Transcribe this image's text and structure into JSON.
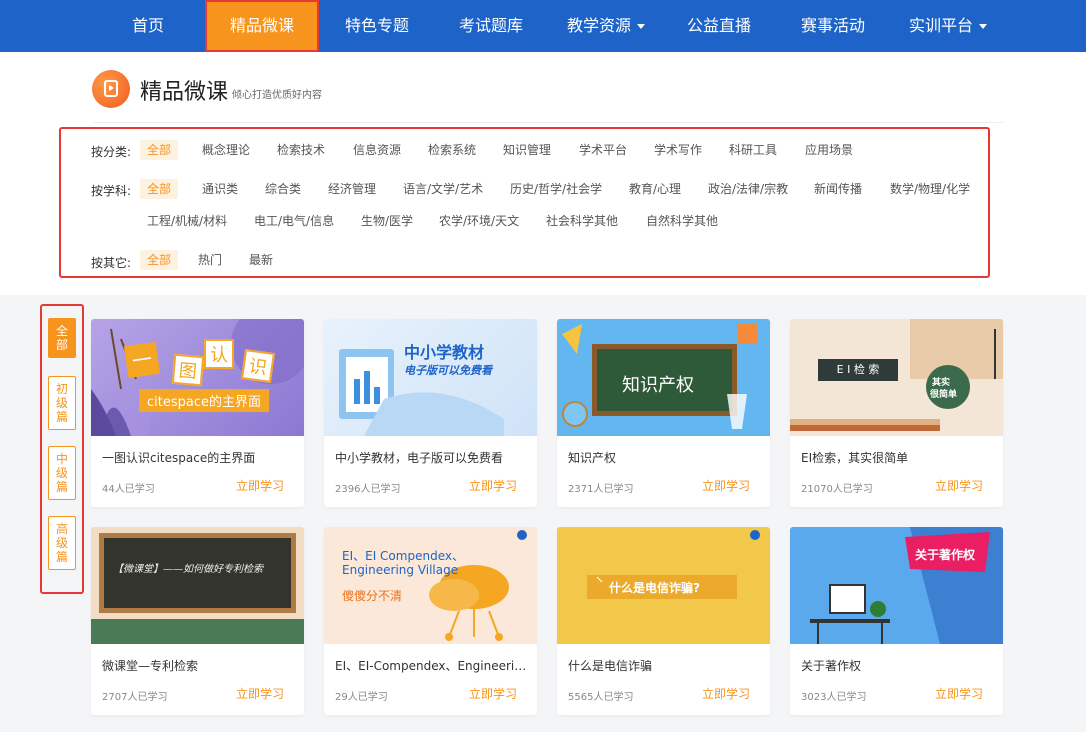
{
  "nav": {
    "items": [
      {
        "label": "首页"
      },
      {
        "label": "精品微课"
      },
      {
        "label": "特色专题"
      },
      {
        "label": "考试题库"
      },
      {
        "label": "教学资源"
      },
      {
        "label": "公益直播"
      },
      {
        "label": "赛事活动"
      },
      {
        "label": "实训平台"
      }
    ],
    "active_index": 1
  },
  "header": {
    "title": "精品微课",
    "subtitle": "倾心打造优质好内容"
  },
  "filters": {
    "category": {
      "label": "按分类:",
      "options": [
        "全部",
        "概念理论",
        "检索技术",
        "信息资源",
        "检索系统",
        "知识管理",
        "学术平台",
        "学术写作",
        "科研工具",
        "应用场景"
      ]
    },
    "subject": {
      "label": "按学科:",
      "options": [
        "全部",
        "通识类",
        "综合类",
        "经济管理",
        "语言/文学/艺术",
        "历史/哲学/社会学",
        "教育/心理",
        "政治/法律/宗教",
        "新闻传播",
        "数学/物理/化学",
        "工程/机械/材料",
        "电工/电气/信息",
        "生物/医学",
        "农学/环境/天文",
        "社会科学其他",
        "自然科学其他"
      ]
    },
    "other": {
      "label": "按其它:",
      "options": [
        "全部",
        "热门",
        "最新"
      ]
    }
  },
  "levels": [
    "全部",
    "初级篇",
    "中级篇",
    "高级篇"
  ],
  "card_button_label": "立即学习",
  "cards": [
    {
      "title": "一图认识citespace的主界面",
      "count": "44人已学习",
      "thumb": {
        "t1": "一",
        "t2": "图",
        "t3": "认",
        "t4": "识",
        "banner": "citespace的主界面"
      }
    },
    {
      "title": "中小学教材，电子版可以免费看",
      "count": "2396人已学习",
      "thumb": {
        "t1": "中小学教材",
        "t2": "电子版可以免费看"
      }
    },
    {
      "title": "知识产权",
      "count": "2371人已学习",
      "thumb": {
        "t1": "知识产权"
      }
    },
    {
      "title": "EI检索，其实很简单",
      "count": "21070人已学习",
      "thumb": {
        "t1": "E I 检 索",
        "t2": "其实",
        "t3": "很简单"
      }
    },
    {
      "title": "微课堂—专利检索",
      "count": "2707人已学习",
      "thumb": {
        "t1": "【微课堂】——如何做好专利检索"
      }
    },
    {
      "title": "EI、EI-Compendex、Engineering Village",
      "count": "29人已学习",
      "thumb": {
        "t1": "EI、EI Compendex、",
        "t2": "Engineering Village",
        "t3": "傻傻分不清"
      }
    },
    {
      "title": "什么是电信诈骗",
      "count": "5565人已学习",
      "thumb": {
        "t1": "什么是电信诈骗?"
      }
    },
    {
      "title": "关于著作权",
      "count": "3023人已学习",
      "thumb": {
        "t1": "关于著作权"
      }
    }
  ],
  "colors": {
    "nav_bg": "#1e64c8",
    "accent": "#f7941d",
    "highlight_border": "#e53935"
  }
}
